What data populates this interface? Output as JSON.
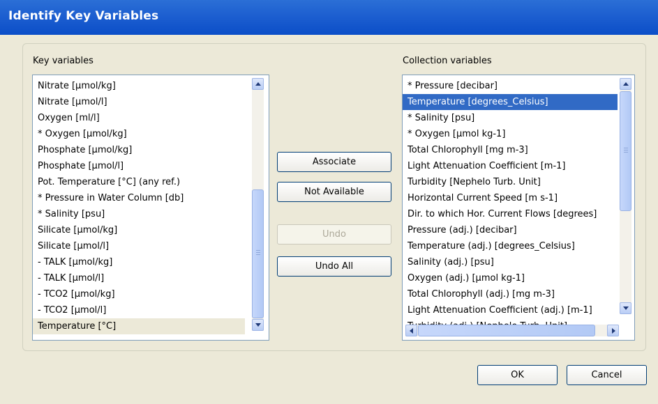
{
  "window": {
    "title": "Identify Key Variables"
  },
  "key_panel": {
    "label": "Key variables",
    "items": [
      "Nitrate [µmol/kg]",
      "Nitrate [µmol/l]",
      "Oxygen [ml/l]",
      "* Oxygen [µmol/kg]",
      "Phosphate [µmol/kg]",
      "Phosphate [µmol/l]",
      "Pot. Temperature [°C] (any ref.)",
      "* Pressure in Water Column [db]",
      "* Salinity [psu]",
      "Silicate [µmol/kg]",
      "Silicate [µmol/l]",
      "- TALK [µmol/kg]",
      "- TALK [µmol/l]",
      "- TCO2 [µmol/kg]",
      "- TCO2 [µmol/l]",
      "Temperature [°C]"
    ],
    "selected": "Temperature [°C]"
  },
  "collection_panel": {
    "label": "Collection variables",
    "items": [
      "* Pressure [decibar]",
      "Temperature [degrees_Celsius]",
      "* Salinity [psu]",
      "* Oxygen [µmol kg-1]",
      "Total Chlorophyll [mg m-3]",
      "Light Attenuation Coefficient [m-1]",
      "Turbidity [Nephelo Turb. Unit]",
      "Horizontal Current Speed [m s-1]",
      "Dir. to which Hor. Current Flows [degrees]",
      "Pressure (adj.) [decibar]",
      "Temperature (adj.) [degrees_Celsius]",
      "Salinity (adj.) [psu]",
      "Oxygen (adj.) [µmol kg-1]",
      "Total Chlorophyll (adj.) [mg m-3]",
      "Light Attenuation Coefficient (adj.) [m-1]",
      "Turbidity (adj.) [Nephelo Turb. Unit]"
    ],
    "selected": "Temperature [degrees_Celsius]"
  },
  "actions": {
    "associate": "Associate",
    "not_available": "Not Available",
    "undo": "Undo",
    "undo_all": "Undo All"
  },
  "footer": {
    "ok": "OK",
    "cancel": "Cancel"
  },
  "colors": {
    "title_bar": "#0b4ec8",
    "dialog_bg": "#ece9d8",
    "selection": "#316ac5",
    "key_selection": "#ece9d8"
  }
}
